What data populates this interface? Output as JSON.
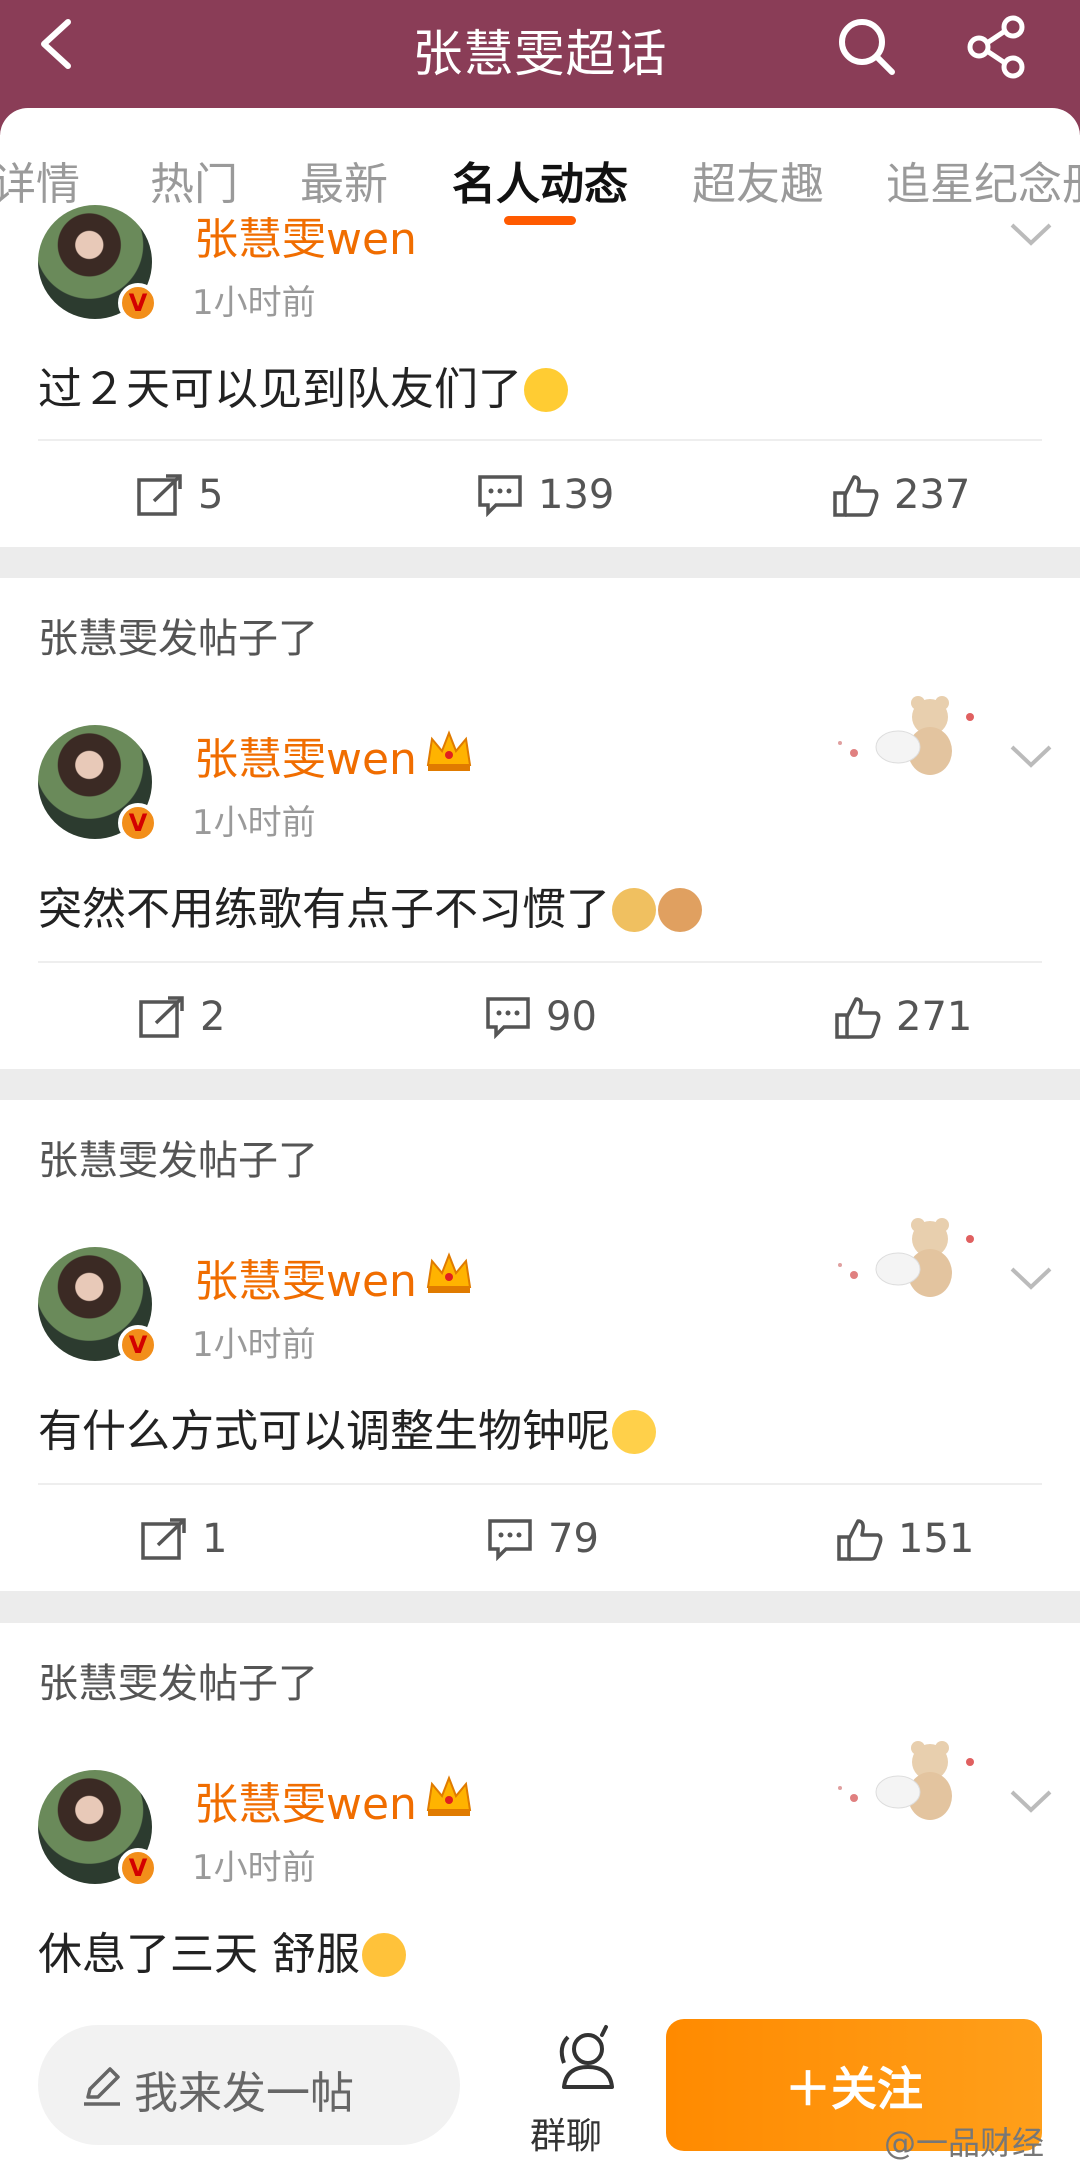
{
  "header": {
    "title": "张慧雯超话"
  },
  "tabs": [
    "详情",
    "热门",
    "最新",
    "名人动态",
    "超友趣",
    "追星纪念册"
  ],
  "active_tab": "名人动态",
  "section_label": "张慧雯发帖子了",
  "posts": [
    {
      "author": "张慧雯wen",
      "time": "1小时前",
      "text": "过２天可以见到队友们了",
      "reposts": "5",
      "comments": "139",
      "likes": "237"
    },
    {
      "author": "张慧雯wen",
      "time": "1小时前",
      "text": "突然不用练歌有点子不习惯了",
      "reposts": "2",
      "comments": "90",
      "likes": "271"
    },
    {
      "author": "张慧雯wen",
      "time": "1小时前",
      "text": "有什么方式可以调整生物钟呢",
      "reposts": "1",
      "comments": "79",
      "likes": "151"
    },
    {
      "author": "张慧雯wen",
      "time": "1小时前",
      "text": "休息了三天 舒服"
    }
  ],
  "verified_badge": "V",
  "bottom": {
    "compose_label": "我来发一帖",
    "group_chat_label": "群聊",
    "follow_label": "＋关注"
  },
  "watermark": "@一品财经",
  "colors": {
    "header_bg": "#8a3d57",
    "accent_orange": "#ff8a00",
    "author_name": "#f06d00",
    "tab_underline": "#ff5a00"
  }
}
